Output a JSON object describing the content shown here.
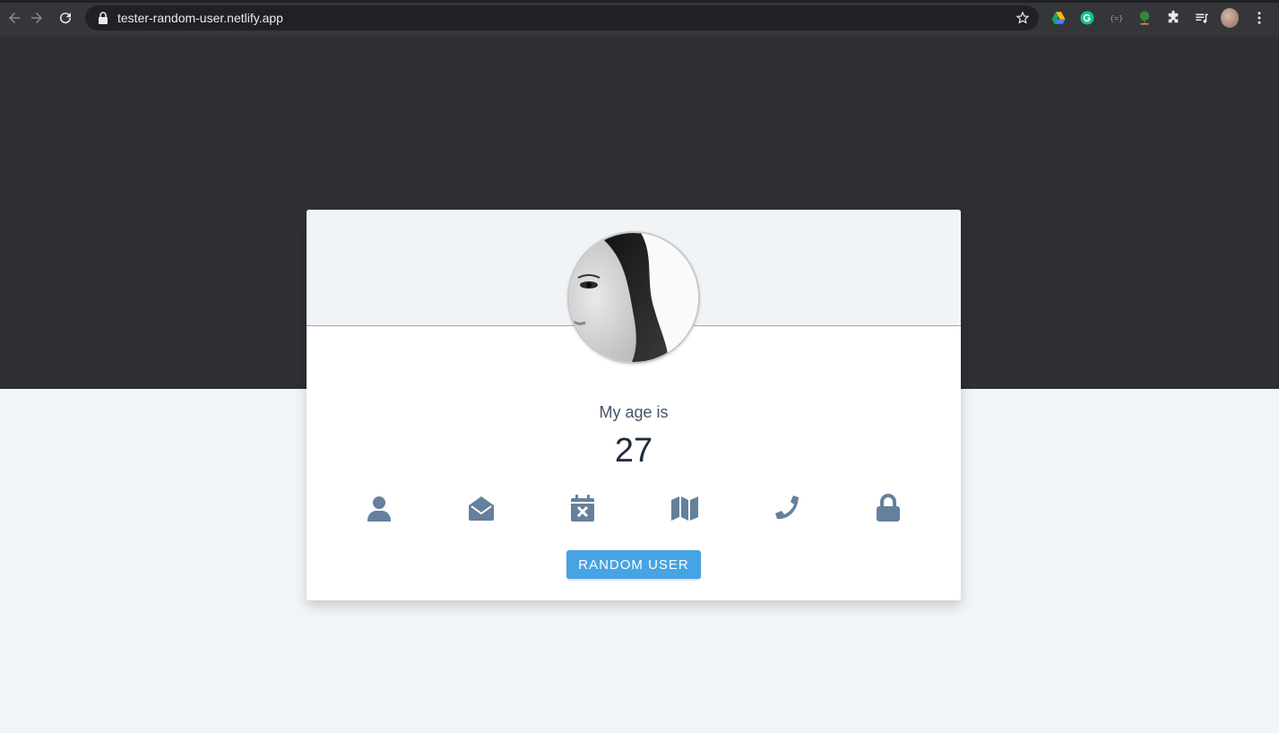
{
  "browser": {
    "url": "tester-random-user.netlify.app"
  },
  "card": {
    "label": "My age is",
    "value": "27",
    "button_label": "RANDOM USER",
    "icons": [
      {
        "name": "user-icon"
      },
      {
        "name": "envelope-open-icon"
      },
      {
        "name": "calendar-times-icon"
      },
      {
        "name": "map-icon"
      },
      {
        "name": "phone-icon"
      },
      {
        "name": "lock-icon"
      }
    ]
  },
  "colors": {
    "dark_band": "#2e3035",
    "page_bg": "#f1f5f8",
    "icon": "#65809c",
    "button": "#46a4e4"
  }
}
